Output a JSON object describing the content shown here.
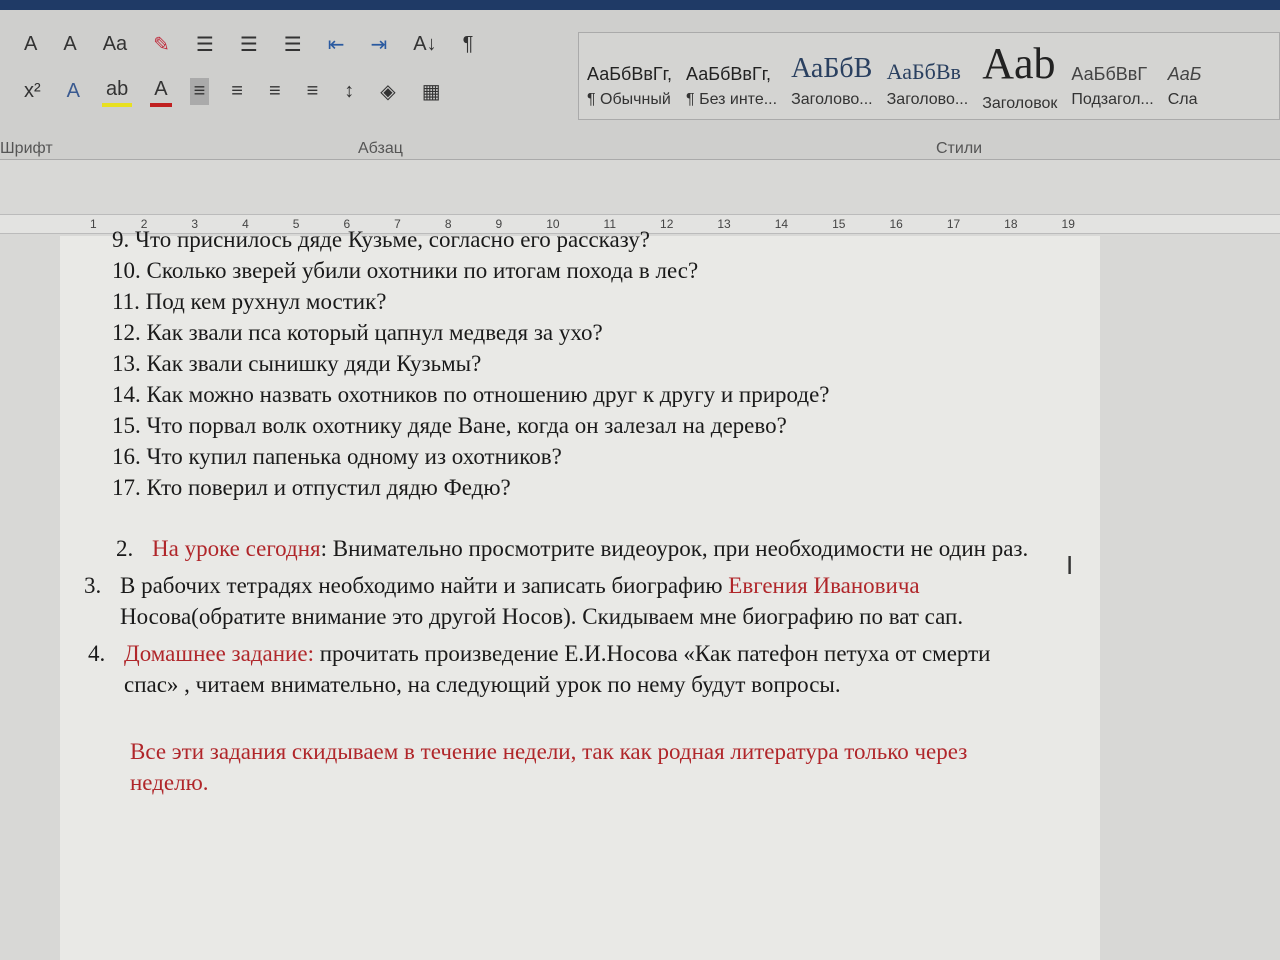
{
  "ribbon": {
    "font_group": "Шрифт",
    "paragraph_group": "Абзац",
    "styles_group": "Стили",
    "row1": [
      "A",
      "A",
      "Aa",
      "✎",
      "☰",
      "☰",
      "☰",
      "⇤",
      "⇥",
      "А↓",
      "¶"
    ],
    "row2": [
      "x²",
      "A",
      "ab",
      "A",
      "≡",
      "≡",
      "≡",
      "≡",
      "↕",
      "◈",
      "▦"
    ],
    "styles": [
      {
        "preview": "АаБбВвГг,",
        "name": "¶ Обычный"
      },
      {
        "preview": "АаБбВвГг,",
        "name": "¶ Без инте..."
      },
      {
        "preview": "АаБбВ",
        "name": "Заголово..."
      },
      {
        "preview": "АаБбВв",
        "name": "Заголово..."
      },
      {
        "preview": "Aab",
        "name": "Заголовок"
      },
      {
        "preview": "АаБбВвГ",
        "name": "Подзагол..."
      },
      {
        "preview": "АаБ",
        "name": "Сла"
      }
    ]
  },
  "ruler": [
    "1",
    "2",
    "3",
    "4",
    "5",
    "6",
    "7",
    "8",
    "9",
    "10",
    "11",
    "12",
    "13",
    "14",
    "15",
    "16",
    "17",
    "18",
    "19"
  ],
  "doc": {
    "questions": [
      "9. Что приснилось дяде Кузьме, согласно его рассказу?",
      "10. Сколько зверей убили охотники по итогам похода в лес?",
      "11. Под кем рухнул мостик?",
      "12. Как звали пса который цапнул медведя за ухо?",
      "13. Как звали сынишку дяди Кузьмы?",
      "14. Как можно назвать охотников по отношению друг к другу и природе?",
      "15. Что порвал волк охотнику дяде Ване, когда он залезал на дерево?",
      "16. Что купил папенька одному из охотников?",
      "17. Кто поверил и отпустил дядю Федю?"
    ],
    "item2": {
      "num": "2.",
      "red": "На уроке сегодня",
      "text": ": Внимательно просмотрите видеоурок, при необходимости не один раз."
    },
    "item3": {
      "num": "3.",
      "text1": "В рабочих тетрадях необходимо найти и записать  биографию ",
      "red": "Евгения Ивановича",
      "text2": " Носова(обратите внимание это другой Носов). Скидываем мне биографию по ват сап."
    },
    "item4": {
      "num": "4.",
      "red": "Домашнее задание:",
      "text": " прочитать  произведение Е.И.Носова «Как патефон петуха от смерти спас» , читаем внимательно, на следующий урок по нему будут вопросы."
    },
    "note": "Все эти задания скидываем в течение недели, так как родная литература только через неделю."
  },
  "colors": {
    "accent_red": "#b0262a",
    "titlebar": "#1f3a66"
  }
}
